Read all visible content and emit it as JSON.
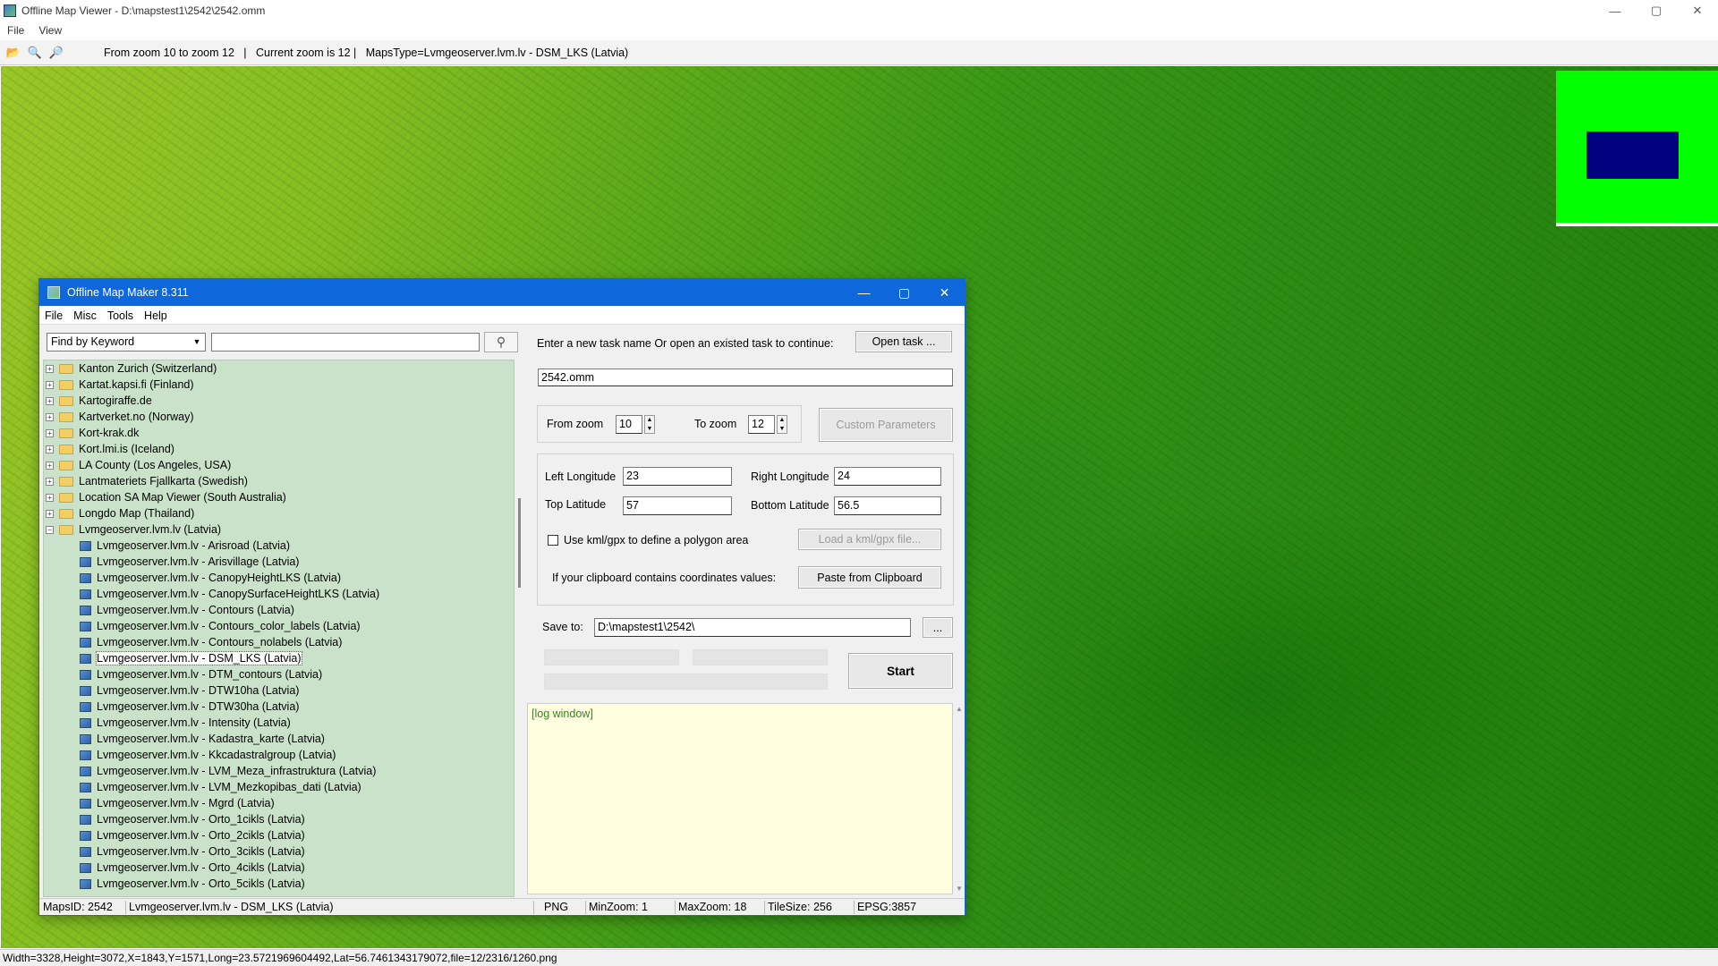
{
  "window": {
    "title": "Offline Map Viewer - D:\\mapstest1\\2542\\2542.omm",
    "minimize": "—",
    "maximize": "▢",
    "close": "✕"
  },
  "menu": [
    "File",
    "View"
  ],
  "toolbar": {
    "info": "From zoom 10 to zoom 12   |   Current zoom is 12 |   MapsType=Lvmgeoserver.lvm.lv - DSM_LKS (Latvia)"
  },
  "status": "Width=3328,Height=3072,X=1843,Y=1571,Long=23.5721969604492,Lat=56.7461343179072,file=12/2316/1260.png",
  "dialog": {
    "title": "Offline Map Maker 8.311",
    "menu": [
      "File",
      "Misc",
      "Tools",
      "Help"
    ],
    "find_select": "Find by Keyword",
    "find_value": "",
    "tree": [
      {
        "label": "Kanton Zurich (Switzerland)",
        "kind": "folder",
        "exp": "+"
      },
      {
        "label": "Kartat.kapsi.fi (Finland)",
        "kind": "folder",
        "exp": "+"
      },
      {
        "label": "Kartogiraffe.de",
        "kind": "folder",
        "exp": "+"
      },
      {
        "label": "Kartverket.no (Norway)",
        "kind": "folder",
        "exp": "+"
      },
      {
        "label": "Kort-krak.dk",
        "kind": "folder",
        "exp": "+"
      },
      {
        "label": "Kort.lmi.is (Iceland)",
        "kind": "folder",
        "exp": "+"
      },
      {
        "label": "LA County (Los Angeles, USA)",
        "kind": "folder",
        "exp": "+"
      },
      {
        "label": "Lantmateriets Fjallkarta (Swedish)",
        "kind": "folder",
        "exp": "+"
      },
      {
        "label": "Location SA Map Viewer (South Australia)",
        "kind": "folder",
        "exp": "+"
      },
      {
        "label": "Longdo Map (Thailand)",
        "kind": "folder",
        "exp": "+"
      },
      {
        "label": "Lvmgeoserver.lvm.lv (Latvia)",
        "kind": "folder",
        "exp": "−"
      },
      {
        "label": "Lvmgeoserver.lvm.lv - Arisroad (Latvia)",
        "kind": "map"
      },
      {
        "label": "Lvmgeoserver.lvm.lv - Arisvillage (Latvia)",
        "kind": "map"
      },
      {
        "label": "Lvmgeoserver.lvm.lv - CanopyHeightLKS (Latvia)",
        "kind": "map"
      },
      {
        "label": "Lvmgeoserver.lvm.lv - CanopySurfaceHeightLKS (Latvia)",
        "kind": "map"
      },
      {
        "label": "Lvmgeoserver.lvm.lv - Contours (Latvia)",
        "kind": "map"
      },
      {
        "label": "Lvmgeoserver.lvm.lv - Contours_color_labels (Latvia)",
        "kind": "map"
      },
      {
        "label": "Lvmgeoserver.lvm.lv - Contours_nolabels (Latvia)",
        "kind": "map"
      },
      {
        "label": "Lvmgeoserver.lvm.lv - DSM_LKS (Latvia)",
        "kind": "map",
        "selected": true
      },
      {
        "label": "Lvmgeoserver.lvm.lv - DTM_contours (Latvia)",
        "kind": "map"
      },
      {
        "label": "Lvmgeoserver.lvm.lv - DTW10ha (Latvia)",
        "kind": "map"
      },
      {
        "label": "Lvmgeoserver.lvm.lv - DTW30ha (Latvia)",
        "kind": "map"
      },
      {
        "label": "Lvmgeoserver.lvm.lv - Intensity (Latvia)",
        "kind": "map"
      },
      {
        "label": "Lvmgeoserver.lvm.lv - Kadastra_karte (Latvia)",
        "kind": "map"
      },
      {
        "label": "Lvmgeoserver.lvm.lv - Kkcadastralgroup (Latvia)",
        "kind": "map"
      },
      {
        "label": "Lvmgeoserver.lvm.lv - LVM_Meza_infrastruktura (Latvia)",
        "kind": "map"
      },
      {
        "label": "Lvmgeoserver.lvm.lv - LVM_Mezkopibas_dati (Latvia)",
        "kind": "map"
      },
      {
        "label": "Lvmgeoserver.lvm.lv - Mgrd (Latvia)",
        "kind": "map"
      },
      {
        "label": "Lvmgeoserver.lvm.lv - Orto_1cikls (Latvia)",
        "kind": "map"
      },
      {
        "label": "Lvmgeoserver.lvm.lv - Orto_2cikls (Latvia)",
        "kind": "map"
      },
      {
        "label": "Lvmgeoserver.lvm.lv - Orto_3cikls (Latvia)",
        "kind": "map"
      },
      {
        "label": "Lvmgeoserver.lvm.lv - Orto_4cikls (Latvia)",
        "kind": "map"
      },
      {
        "label": "Lvmgeoserver.lvm.lv - Orto_5cikls (Latvia)",
        "kind": "map"
      }
    ],
    "task_prompt": "Enter a new task name Or open an existed task to continue:",
    "open_task": "Open task ...",
    "task_name": "2542.omm",
    "from_zoom_label": "From zoom",
    "from_zoom": "10",
    "to_zoom_label": "To zoom",
    "to_zoom": "12",
    "custom_params": "Custom Parameters",
    "left_lon_label": "Left Longitude",
    "left_lon": "23",
    "right_lon_label": "Right Longitude",
    "right_lon": "24",
    "top_lat_label": "Top Latitude",
    "top_lat": "57",
    "bottom_lat_label": "Bottom Latitude",
    "bottom_lat": "56.5",
    "kml_label": "Use kml/gpx to define a polygon area",
    "load_kml": "Load a kml/gpx file...",
    "clipboard_label": "If your clipboard contains coordinates values:",
    "paste_clipboard": "Paste from Clipboard",
    "save_to_label": "Save to:",
    "save_to": "D:\\mapstest1\\2542\\",
    "browse": "...",
    "start": "Start",
    "log": "[log window]",
    "status": {
      "maps_id": "MapsID: 2542",
      "map_name": "Lvmgeoserver.lvm.lv - DSM_LKS (Latvia)",
      "format": "PNG",
      "min_zoom": "MinZoom: 1",
      "max_zoom": "MaxZoom: 18",
      "tile_size": "TileSize: 256",
      "epsg": "EPSG:3857"
    }
  }
}
